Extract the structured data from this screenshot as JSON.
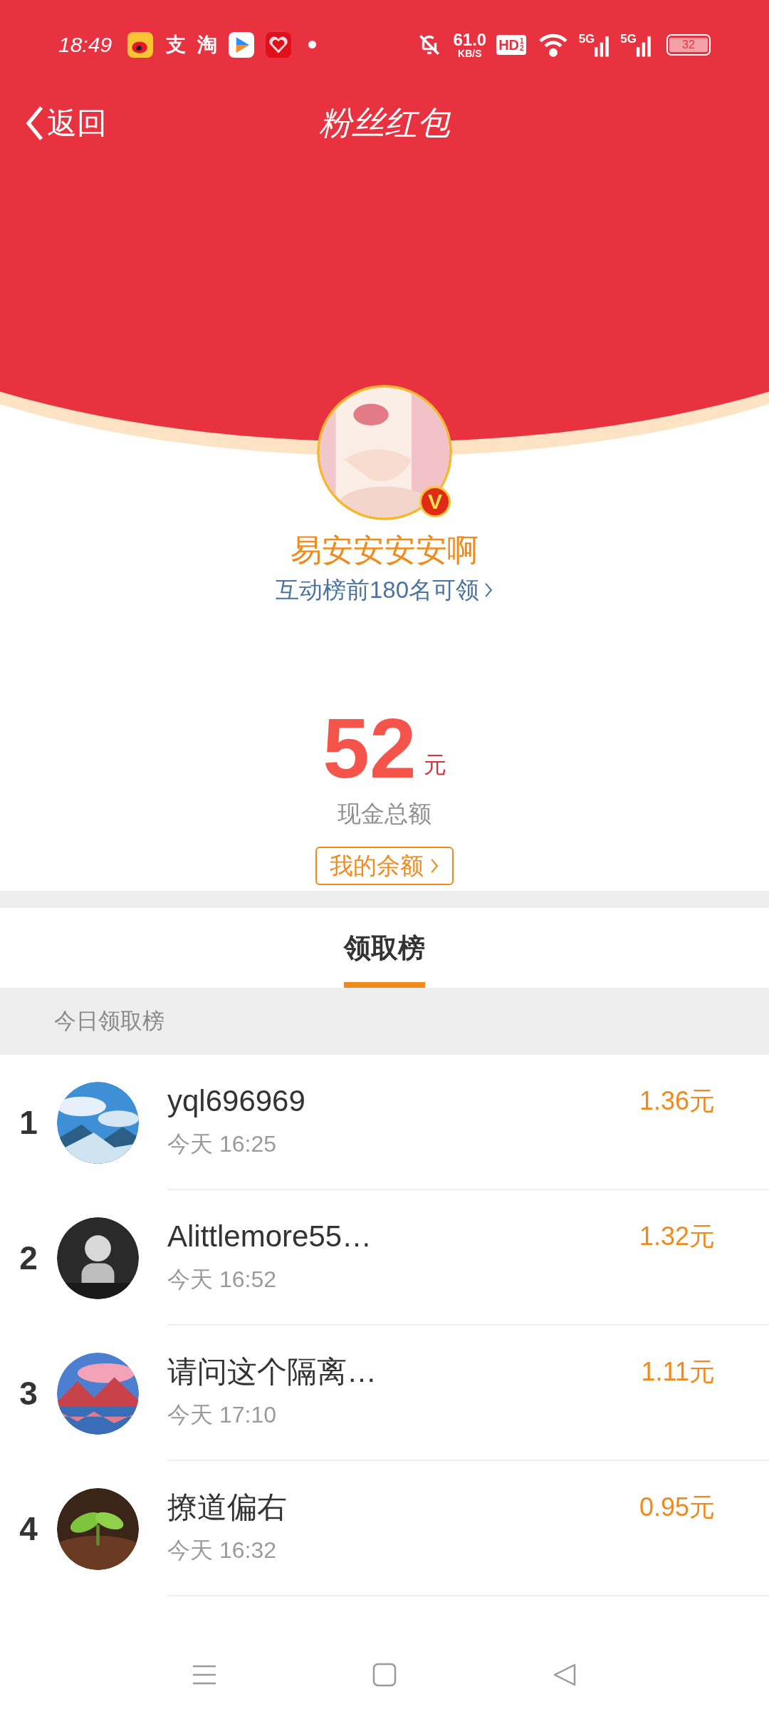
{
  "status_bar": {
    "time": "18:49",
    "app_glyphs": [
      "支",
      "淘"
    ],
    "network_speed": "61.0",
    "network_unit": "KB/S",
    "hd_label": "HD",
    "hd_sub": [
      "1",
      "2"
    ],
    "signal_labels": [
      "5G",
      "5G"
    ],
    "battery": "32"
  },
  "header": {
    "back_label": "返回",
    "title": "粉丝红包"
  },
  "profile": {
    "name": "易安安安安啊",
    "verified_badge": "V",
    "note": "互动榜前180名可领"
  },
  "total": {
    "amount": "52",
    "unit": "元",
    "label": "现金总额",
    "balance_button": "我的余额"
  },
  "tabs": [
    {
      "label": "领取榜",
      "selected": true
    }
  ],
  "section_title": "今日领取榜",
  "rows": [
    {
      "rank": "1",
      "name": "yql696969",
      "time": "今天 16:25",
      "amount": "1.36元"
    },
    {
      "rank": "2",
      "name": "Alittlemore55…",
      "time": "今天 16:52",
      "amount": "1.32元"
    },
    {
      "rank": "3",
      "name": "请问这个隔离…",
      "time": "今天 17:10",
      "amount": "1.11元"
    },
    {
      "rank": "4",
      "name": "撩道偏右",
      "time": "今天 16:32",
      "amount": "0.95元"
    }
  ]
}
